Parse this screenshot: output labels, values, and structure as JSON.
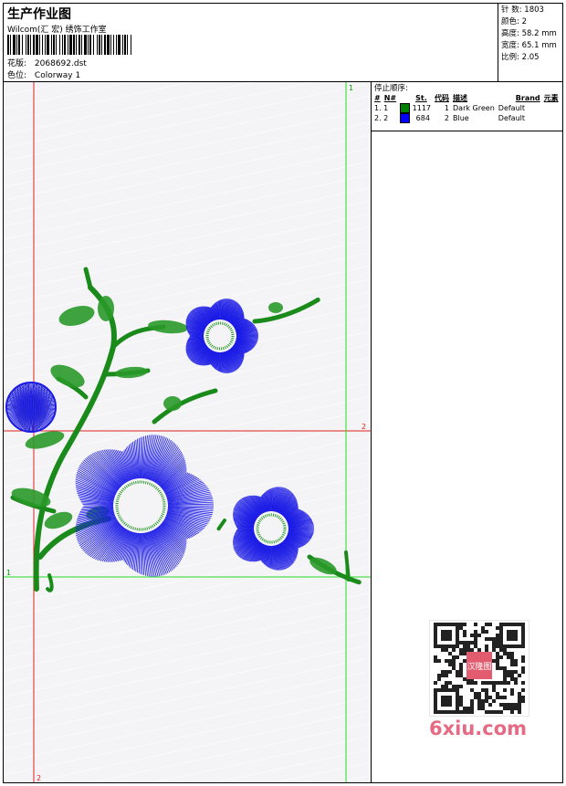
{
  "header": {
    "title": "生产作业图",
    "subtitle": "Wilcom(汇 宏) 绣饰工作室",
    "design_file_label": "花版:",
    "design_file": "2068692.dst",
    "colorway_label": "色位:",
    "colorway": "Colorway 1"
  },
  "info": {
    "stitches_label": "针 数:",
    "stitches": "1803",
    "colors_label": "颜色:",
    "colors": "2",
    "height_label": "高度:",
    "height": "58.2 mm",
    "width_label": "宽度:",
    "width": "65.1 mm",
    "ratio_label": "比例:",
    "ratio": "2.05"
  },
  "stop_sequence": {
    "title": "停止顺序:",
    "columns": [
      "#",
      "N#",
      "St.",
      "代码",
      "描述",
      "Brand",
      "元素"
    ],
    "rows": [
      {
        "index": "1. 1",
        "color": "#008000",
        "stitches": "1117",
        "code": "1",
        "description": "Dark Green",
        "brand": "Default"
      },
      {
        "index": "2. 2",
        "color": "#0000ff",
        "stitches": "684",
        "code": "2",
        "description": "Blue",
        "brand": "Default"
      }
    ]
  },
  "markers": {
    "top_green": "1",
    "left_green": "1",
    "right_red": "2",
    "bottom_red": "2"
  },
  "watermark": "6xiu.com",
  "qr_stamp": "汉隆图"
}
